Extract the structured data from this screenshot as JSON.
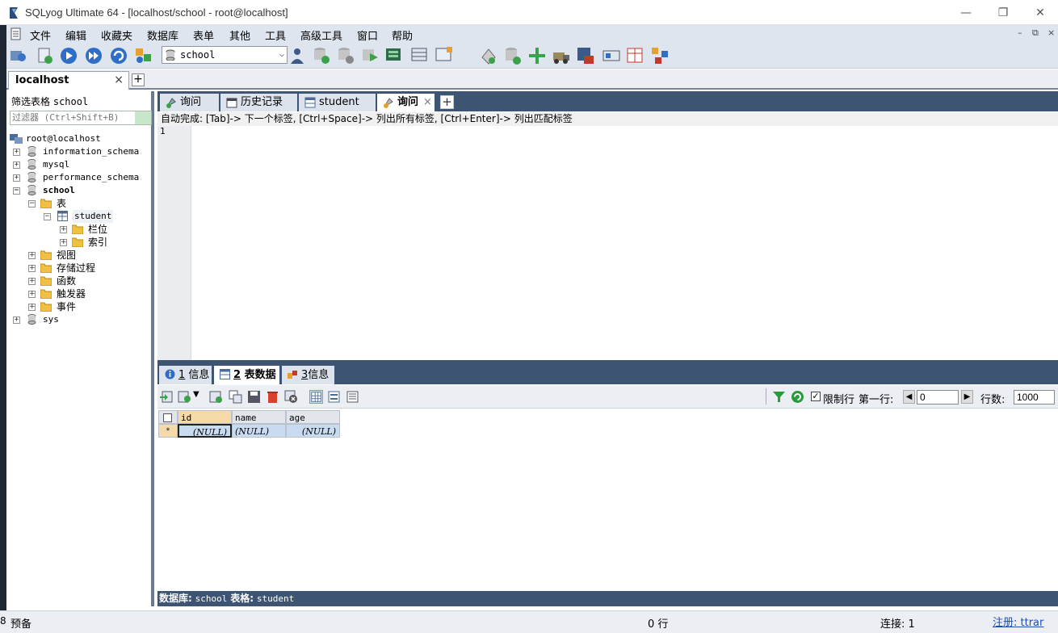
{
  "window": {
    "title": "SQLyog Ultimate 64 - [localhost/school - root@localhost]",
    "controls": {
      "minimize": "—",
      "restore": "❐",
      "close": "✕"
    }
  },
  "menu": {
    "items": [
      "文件",
      "编辑",
      "收藏夹",
      "数据库",
      "表单",
      "其他",
      "工具",
      "高级工具",
      "窗口",
      "帮助"
    ],
    "mdi_controls": [
      "–",
      "⧉",
      "×"
    ]
  },
  "toolbar": {
    "database_select": "school"
  },
  "connection_tab": {
    "label": "localhost",
    "close": "×",
    "add": "+"
  },
  "left_panel": {
    "filter_label": "筛选表格",
    "filter_db": "school",
    "filter_placeholder": "过滤器 (Ctrl+Shift+B)",
    "tree": {
      "root": "root@localhost",
      "db_information_schema": "information_schema",
      "db_mysql": "mysql",
      "db_performance_schema": "performance_schema",
      "db_school": "school",
      "folder_tables": "表",
      "table_student": "student",
      "folder_columns": "栏位",
      "folder_indexes": "索引",
      "folder_views": "视图",
      "folder_procedures": "存储过程",
      "folder_functions": "函数",
      "folder_triggers": "触发器",
      "folder_events": "事件",
      "db_sys": "sys",
      "expand_plus": "+",
      "expand_minus": "−"
    }
  },
  "query_tabs": {
    "tab1": "询问",
    "tab2": "历史记录",
    "tab3": "student",
    "tab4": "询问",
    "tab4_close": "×",
    "add": "+"
  },
  "editor": {
    "hint": "自动完成: [Tab]-> 下一个标签, [Ctrl+Space]-> 列出所有标签, [Ctrl+Enter]-> 列出匹配标签",
    "line_number": "1"
  },
  "result_tabs": {
    "tab1_num": "1",
    "tab1_label": "信息",
    "tab2_num": "2",
    "tab2_label": "表数据",
    "tab3_num": "3",
    "tab3_label": "信息"
  },
  "result_toolbar": {
    "limit_label": "限制行",
    "limit_checked": true,
    "first_row_label": "第一行:",
    "first_row_value": "0",
    "rows_label": "行数:",
    "rows_value": "1000"
  },
  "grid": {
    "columns": [
      "id",
      "name",
      "age"
    ],
    "rows": [
      {
        "marker": "*",
        "cells": [
          "(NULL)",
          "(NULL)",
          "(NULL)"
        ]
      }
    ]
  },
  "info_bar": {
    "db_label": "数据库:",
    "db_value": "school",
    "table_label": "表格:",
    "table_value": "student"
  },
  "status_bar": {
    "left_marker": "8",
    "left_text": "预备",
    "rows": "0 行",
    "connection": "连接: 1",
    "register": "注册: ttrar"
  },
  "colors": {
    "accent_dark": "#3d5573",
    "toolbar_bg": "#dfe5ee",
    "null_cell": "#c9dbf1"
  }
}
